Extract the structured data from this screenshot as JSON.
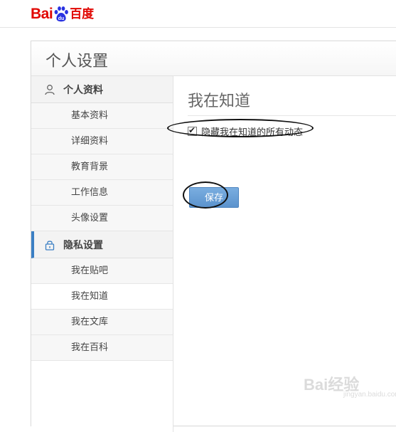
{
  "brand": {
    "logo_left": "Bai",
    "logo_paw": "du",
    "logo_cn": "百度",
    "color": "#e10601"
  },
  "panel": {
    "title": "个人设置"
  },
  "sidebar": {
    "groups": [
      {
        "label": "个人资料",
        "icon": "user-icon",
        "items": [
          "基本资料",
          "详细资料",
          "教育背景",
          "工作信息",
          "头像设置"
        ]
      },
      {
        "label": "隐私设置",
        "icon": "lock-icon",
        "active": true,
        "items": [
          "我在贴吧",
          "我在知道",
          "我在文库",
          "我在百科"
        ],
        "selected_index": 1
      }
    ]
  },
  "content": {
    "title": "我在知道",
    "checkbox_label": "隐藏我在知道的所有动态",
    "checkbox_checked": true,
    "save_label": "保存",
    "accent": "#3b7fc4"
  },
  "watermark": {
    "text": "Bai经验",
    "sub": "jingyan.baidu.com"
  }
}
